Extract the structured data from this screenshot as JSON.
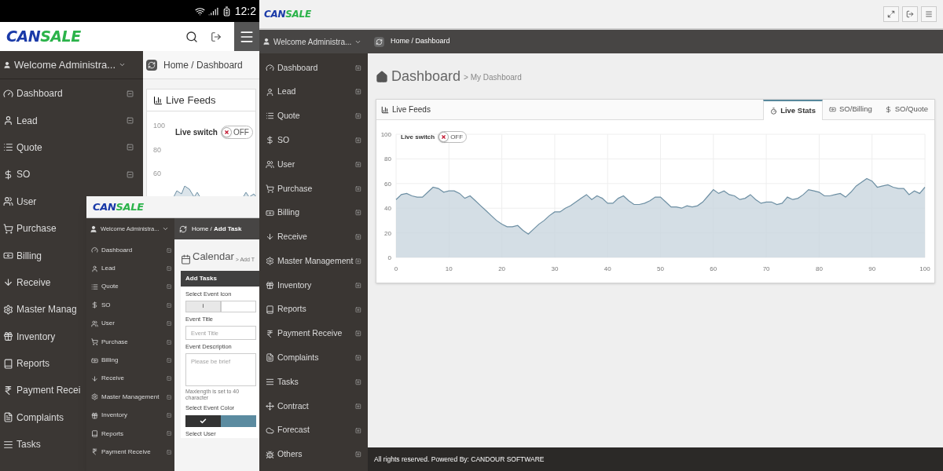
{
  "phone": {
    "status_bar": {
      "time": "12:2"
    },
    "logo": {
      "first": "CAN",
      "second": "SALE"
    },
    "welcome": "Welcome Administra...",
    "sidebar": [
      {
        "label": "Dashboard"
      },
      {
        "label": "Lead"
      },
      {
        "label": "Quote"
      },
      {
        "label": "SO"
      },
      {
        "label": "User"
      },
      {
        "label": "Purchase"
      },
      {
        "label": "Billing"
      },
      {
        "label": "Receive"
      },
      {
        "label": "Master Manag"
      },
      {
        "label": "Inventory"
      },
      {
        "label": "Reports"
      },
      {
        "label": "Payment Recei"
      },
      {
        "label": "Complaints"
      },
      {
        "label": "Tasks"
      }
    ],
    "breadcrumb": {
      "home": "Home",
      "separator": "/",
      "current": "Dashboard"
    },
    "panel_title": "Live Feeds",
    "live_switch": {
      "label": "Live switch",
      "on": false,
      "text": "OFF"
    },
    "y_labels": [
      "100",
      "80",
      "60"
    ]
  },
  "tablet": {
    "logo": {
      "first": "CAN",
      "second": "SALE"
    },
    "welcome": "Welcome Administra...",
    "sidebar": [
      {
        "label": "Dashboard"
      },
      {
        "label": "Lead"
      },
      {
        "label": "Quote"
      },
      {
        "label": "SO"
      },
      {
        "label": "User"
      },
      {
        "label": "Purchase"
      },
      {
        "label": "Billing"
      },
      {
        "label": "Receive"
      },
      {
        "label": "Master Management"
      },
      {
        "label": "Inventory"
      },
      {
        "label": "Reports"
      },
      {
        "label": "Payment Receive"
      }
    ],
    "breadcrumb": {
      "home": "Home",
      "separator": "/",
      "current": "Add Task"
    },
    "page_title": "Calendar",
    "page_subtitle": "> Add T",
    "form": {
      "title": "Add Tasks",
      "icon_label": "Select Event Icon",
      "icon_options": [
        {
          "label": "i",
          "selected": true
        },
        {
          "selected": false
        }
      ],
      "title_label": "Event Title",
      "title_placeholder": "Event Title",
      "description_label": "Event Description",
      "description_placeholder": "Please be brief",
      "hint": "Maxlength is set to 40 character",
      "color_label": "Select Event Color",
      "colors": [
        {
          "color": "#333333",
          "selected": true
        },
        {
          "color": "#5b8ba0",
          "selected": false
        }
      ],
      "user_label": "Select User"
    }
  },
  "desktop": {
    "logo": {
      "first": "CAN",
      "second": "SALE"
    },
    "welcome": "Welcome Administra...",
    "sidebar": [
      {
        "label": "Dashboard"
      },
      {
        "label": "Lead"
      },
      {
        "label": "Quote"
      },
      {
        "label": "SO"
      },
      {
        "label": "User"
      },
      {
        "label": "Purchase"
      },
      {
        "label": "Billing"
      },
      {
        "label": "Receive"
      },
      {
        "label": "Master Management"
      },
      {
        "label": "Inventory"
      },
      {
        "label": "Reports"
      },
      {
        "label": "Payment Receive"
      },
      {
        "label": "Complaints"
      },
      {
        "label": "Tasks"
      },
      {
        "label": "Contract"
      },
      {
        "label": "Forecast"
      },
      {
        "label": "Others"
      }
    ],
    "breadcrumb": {
      "home": "Home",
      "separator": "/",
      "current": "Dashboard"
    },
    "page_title": "Dashboard",
    "page_subtitle": "> My Dashboard",
    "panel": {
      "title": "Live Feeds",
      "tabs": [
        {
          "label": "Live Stats",
          "selected": true
        },
        {
          "label": "SO/Billing",
          "selected": false
        },
        {
          "label": "SO/Quote",
          "selected": false
        }
      ],
      "live_switch": {
        "label": "Live switch",
        "on": false,
        "text": "OFF"
      },
      "chart_data": {
        "type": "area",
        "grid": true,
        "x": [
          0,
          1,
          2,
          3,
          4,
          5,
          6,
          7,
          8,
          9,
          10,
          11,
          12,
          13,
          14,
          15,
          16,
          17,
          18,
          19,
          20,
          21,
          22,
          23,
          24,
          25,
          26,
          27,
          28,
          29,
          30,
          31,
          32,
          33,
          34,
          35,
          36,
          37,
          38,
          39,
          40,
          41,
          42,
          43,
          44,
          45,
          46,
          47,
          48,
          49,
          50,
          51,
          52,
          53,
          54,
          55,
          56,
          57,
          58,
          59,
          60,
          61,
          62,
          63,
          64,
          65,
          66,
          67,
          68,
          69,
          70,
          71,
          72,
          73,
          74,
          75,
          76,
          77,
          78,
          79,
          80,
          81,
          82,
          83,
          84,
          85,
          86,
          87,
          88,
          89,
          90,
          91,
          92,
          93,
          94,
          95,
          96,
          97,
          98,
          99,
          100
        ],
        "xlim": [
          0,
          100
        ],
        "ylim": [
          0,
          100
        ],
        "xticks": [
          0,
          10,
          20,
          30,
          40,
          50,
          60,
          70,
          80,
          90,
          100
        ],
        "yticks": [
          0,
          20,
          40,
          60,
          80,
          100
        ],
        "series": [
          {
            "color": "#6d8fa3",
            "values": [
              47,
              51,
              52,
              50,
              49,
              49,
              53,
              57,
              56,
              53,
              54,
              54,
              52,
              48,
              50,
              46,
              42,
              38,
              34,
              30,
              27,
              25,
              25,
              26,
              22,
              19,
              23,
              27,
              30,
              34,
              37,
              37,
              40,
              42,
              45,
              48,
              51,
              47,
              50,
              48,
              44,
              44,
              48,
              50,
              46,
              43,
              43,
              44,
              46,
              49,
              49,
              45,
              41,
              41,
              40,
              42,
              41,
              42,
              45,
              50,
              55,
              52,
              54,
              51,
              50,
              47,
              48,
              51,
              47,
              44,
              45,
              45,
              43,
              44,
              49,
              47,
              48,
              51,
              55,
              54,
              53,
              50,
              50,
              51,
              52,
              49,
              53,
              58,
              61,
              64,
              62,
              57,
              58,
              59,
              57,
              56,
              56,
              51,
              54,
              52,
              57
            ]
          }
        ]
      }
    },
    "footer": "All rights reserved. Powered By: CANDOUR SOFTWARE"
  }
}
